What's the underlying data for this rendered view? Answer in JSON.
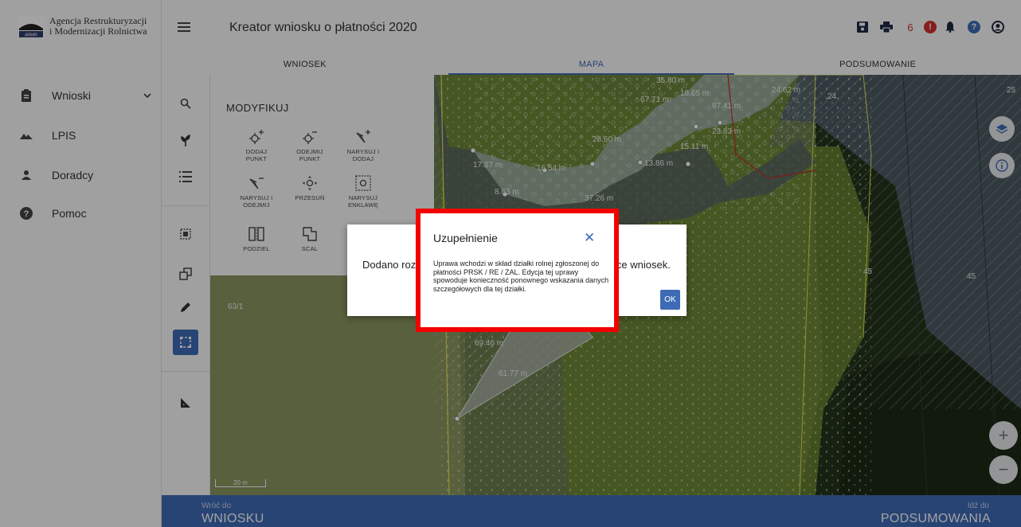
{
  "logo": {
    "line1": "Agencja Restrukturyzacji",
    "line2": "i Modernizacji Rolnictwa",
    "abbr": "ARiMR"
  },
  "sidebar": {
    "items": [
      {
        "label": "Wnioski",
        "icon": "clipboard-icon"
      },
      {
        "label": "LPIS",
        "icon": "mountain-icon"
      },
      {
        "label": "Doradcy",
        "icon": "person-icon"
      },
      {
        "label": "Pomoc",
        "icon": "help-icon"
      }
    ]
  },
  "header": {
    "title": "Kreator wniosku o płatności 2020",
    "notification_count": "6"
  },
  "tabs": [
    {
      "label": "WNIOSEK",
      "active": false
    },
    {
      "label": "MAPA",
      "active": true
    },
    {
      "label": "PODSUMOWANIE",
      "active": false
    }
  ],
  "panel": {
    "title": "MODYFIKUJ",
    "tools": [
      {
        "label1": "DODAJ",
        "label2": "PUNKT"
      },
      {
        "label1": "ODEJMIJ",
        "label2": "PUNKT"
      },
      {
        "label1": "NARYSUJ I",
        "label2": "DODAJ"
      },
      {
        "label1": "NARYSUJ I",
        "label2": "ODEJMIJ"
      },
      {
        "label1": "PRZESUŃ",
        "label2": ""
      },
      {
        "label1": "NARYSUJ",
        "label2": "ENKLAWĘ"
      },
      {
        "label1": "PODZIEL",
        "label2": ""
      },
      {
        "label1": "SCAL",
        "label2": ""
      }
    ]
  },
  "map": {
    "labels": {
      "m1": "35.80 m",
      "m2": "67.71 m",
      "m3": "87.41 m",
      "m4": "24",
      "m5": "25",
      "m6": "28.60 m",
      "m7": "15.11 m",
      "m8": "17.27 m",
      "m9": "16.54 m",
      "m10": "13.86 m",
      "m11": "8.63 m",
      "m12": "37.26 m",
      "m13": "45",
      "m14": "45",
      "m15": "63/1",
      "m16": "69.46 m",
      "m17": "61.77 m",
      "m18": "24.62 m",
      "m19": "18.65 m",
      "m20": "23.83 m"
    },
    "scale": "20 m"
  },
  "dialog_back": {
    "text_start": "Dodano rozb",
    "text_end": "ice wniosek.",
    "ok": "OK"
  },
  "dialog": {
    "title": "Uzupełnienie",
    "close": "✕",
    "body": "Uprawa wchodzi w skład działki rolnej zgłoszonej do płatności PRSK / RE / ZAL. Edycja tej uprawy spowoduje konieczność ponownego wskazania danych szczegółowych dla tej działki."
  },
  "footer": {
    "back_small": "Wróć do",
    "back_big": "WNIOSKU",
    "next_small": "Idź do",
    "next_big": "PODSUMOWANIA"
  },
  "colors": {
    "accent": "#3f6bb6",
    "highlight": "#f20000",
    "alert": "#d32f2f"
  }
}
